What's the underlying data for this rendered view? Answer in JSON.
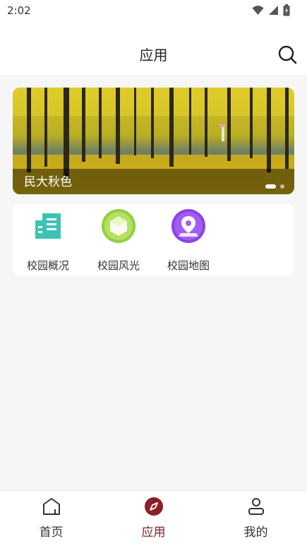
{
  "status_bar": {
    "time": "2:02",
    "icons": [
      "wifi-icon",
      "signal-icon",
      "battery-icon"
    ]
  },
  "header": {
    "title": "应用",
    "search_icon": "search-icon"
  },
  "banner": {
    "caption": "民大秋色",
    "image": "ginkgo-grove-photo",
    "page_count": 2,
    "active_page": 1
  },
  "apps": [
    {
      "label": "校园概况",
      "icon": "building-icon",
      "color": "#3cc3b5"
    },
    {
      "label": "校园风光",
      "icon": "landscape-icon",
      "color": "#8fd13c"
    },
    {
      "label": "校园地图",
      "icon": "map-pin-icon",
      "color": "#8a43e8"
    }
  ],
  "tabbar": {
    "items": [
      {
        "label": "首页",
        "icon": "home-icon",
        "active": false
      },
      {
        "label": "应用",
        "icon": "compass-icon",
        "active": true
      },
      {
        "label": "我的",
        "icon": "profile-icon",
        "active": false
      }
    ],
    "active_color": "#8a1f2a"
  }
}
